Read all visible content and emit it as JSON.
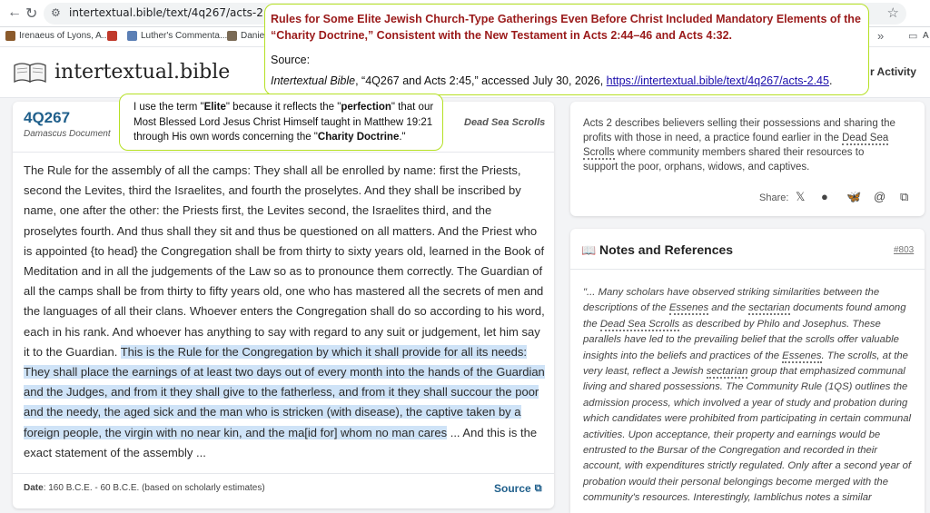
{
  "browser": {
    "url": "intertextual.bible/text/4q267/acts-2.45",
    "bookmarks": [
      {
        "label": "Irenaeus of Lyons, A...",
        "color": "#8b5a2b"
      },
      {
        "label": "",
        "color": "#c0392b"
      },
      {
        "label": "Luther's Commenta...",
        "color": "#5b7fb5"
      },
      {
        "label": "Daniel",
        "color": "#7a6a55"
      }
    ],
    "bookmark_folder_label": "A"
  },
  "site": {
    "logo": "intertextual.bible",
    "nav_activity": "r Activity"
  },
  "document": {
    "id": "4Q267",
    "type": "Damascus Document",
    "collection": "Dead Sea Scrolls",
    "text_before": "The Rule for the assembly of all the camps: They shall all be enrolled by name: first the Priests, second the Levites, third the Israelites, and fourth the proselytes. And they shall be inscribed by name, one after the other: the Priests first, the Levites second, the Israelites third, and the proselytes fourth. And thus shall they sit and thus be questioned on all matters. And the Priest who is appointed {to head} the Congregation shall be from thirty to sixty years old, learned in the Book of Meditation and in all the judgements of the Law so as to pronounce them correctly. The Guardian of all the camps shall be from thirty to fifty years old, one who has mastered all the secrets of men and the languages of all their clans. Whoever enters the Congregation shall do so according to his word, each in his rank. And whoever has anything to say with regard to any suit or judgement, let him say it to the Guardian. ",
    "text_highlight": "This is the Rule for the Congregation by which it shall provide for all its needs: They shall place the earnings of at least two days out of every month into the hands of the Guardian and the Judges, and from it they shall give to the fatherless, and from it they shall succour the poor and the needy, the aged sick and the man who is stricken (with disease), the captive taken by a foreign people, the virgin with no near kin, and the ma[id for] whom no man cares",
    "text_after": " ... And this is the exact statement of the assembly ...",
    "date_label": "Date",
    "date_value": ": 160 B.C.E. - 60 B.C.E. (based on scholarly estimates)",
    "source_label": "Source"
  },
  "summary": {
    "text_before": "Acts 2 describes believers selling their possessions and sharing the profits with those in need, a practice found earlier in the ",
    "term1": "Dead Sea",
    "term2": "Scrolls",
    "text_after": " where community members shared their resources to support the poor, orphans, widows, and captives.",
    "share_label": "Share:",
    "share_icons": [
      "x-icon",
      "facebook-icon",
      "bluesky-icon",
      "threads-icon",
      "copy-icon"
    ]
  },
  "notes": {
    "title": "Notes and References",
    "number": "#803",
    "p1": "\"... Many scholars have observed striking similarities between the descriptions of the ",
    "t1": "Essenes",
    "p2": " and the ",
    "t2": "sectarian",
    "p3": " documents found among the ",
    "t3": "Dead Sea Scrolls",
    "p4": " as described by Philo and Josephus. These parallels have led to the prevailing belief that the scrolls offer valuable insights into the beliefs and practices of the ",
    "t4": "Essenes",
    "p5": ". The scrolls, at the very least, reflect a Jewish ",
    "t5": "sectarian",
    "p6": " group that emphasized communal living and shared possessions. The Community Rule (1QS) outlines the admission process, which involved a year of study and probation during which candidates were prohibited from participating in certain communal activities. Upon acceptance, their property and earnings would be entrusted to the Bursar of the Congregation and recorded in their account, with expenditures strictly regulated. Only after a second year of probation would their personal belongings become merged with the community's resources. Interestingly, Iamblichus notes a similar"
  },
  "overlay_top": {
    "title": "Rules for Some Elite Jewish Church-Type Gatherings Even Before Christ Included Mandatory Elements of the “Charity Doctrine,” Consistent with the New Testament in Acts 2:44–46 and Acts 4:32.",
    "source_label": "Source:",
    "cite_italic": "Intertextual Bible",
    "cite_text": ", “4Q267 and Acts 2:45,” accessed July 30, 2026, ",
    "cite_link": "https://intertextual.bible/text/4q267/acts-2.45",
    "cite_end": "."
  },
  "overlay_mid": {
    "t1": "I use the term \"",
    "b1": "Elite",
    "t2": "\" because it reflects the \"",
    "b2": "perfection",
    "t3": "\" that our Most Blessed Lord Jesus Christ Himself taught in Matthew 19:21 through His own words concerning the \"",
    "b3": "Charity Doctrine",
    "t4": ".\""
  },
  "colors": {
    "accent": "#1f5f8b",
    "overlay_border": "#b5e024",
    "highlight": "#cfe3f7",
    "title_red": "#9a1a1a"
  }
}
